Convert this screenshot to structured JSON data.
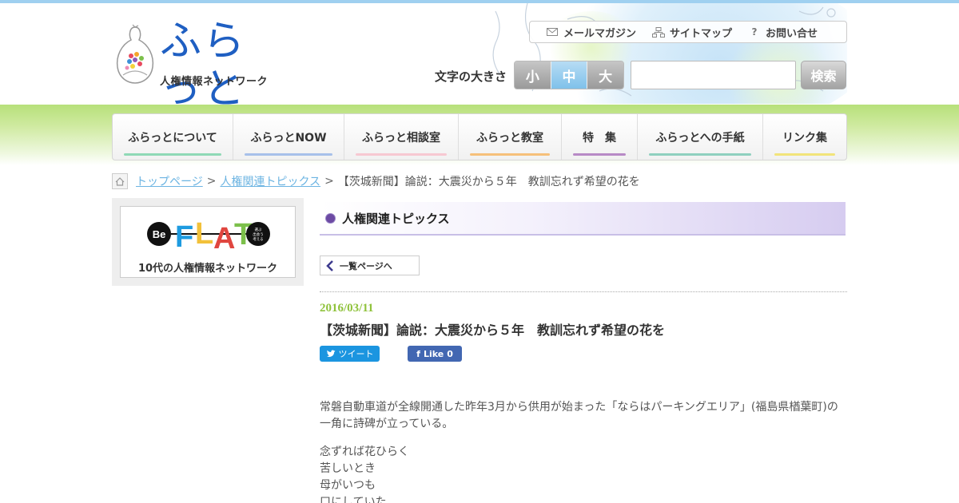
{
  "header": {
    "logo_name": "ふらっと",
    "logo_sub": "人権情報ネットワーク",
    "utility": [
      {
        "label": "メールマガジン",
        "icon": "mail-icon"
      },
      {
        "label": "サイトマップ",
        "icon": "sitemap-icon"
      },
      {
        "label": "お問い合せ",
        "icon": "question-icon"
      }
    ],
    "fontsize_label": "文字の大きさ",
    "fontsize_options": [
      "小",
      "中",
      "大"
    ],
    "fontsize_selected": "中",
    "search_value": "",
    "search_button": "検索"
  },
  "nav": {
    "items": [
      {
        "label": "ふらっとについて",
        "color": "#8fd9b6"
      },
      {
        "label": "ふらっとNOW",
        "color": "#a7c0ea"
      },
      {
        "label": "ふらっと相談室",
        "color": "#f7c8d2"
      },
      {
        "label": "ふらっと教室",
        "color": "#f6c07a"
      },
      {
        "label": "特　集",
        "color": "#b88ac6"
      },
      {
        "label": "ふらっとへの手紙",
        "color": "#8fd0bf"
      },
      {
        "label": "リンク集",
        "color": "#f2e47a"
      }
    ]
  },
  "breadcrumb": {
    "home": "トップページ",
    "category": "人権関連トピックス",
    "current": "【茨城新聞】論説：大震災から５年　教訓忘れず希望の花を",
    "separator": ">"
  },
  "sidebar": {
    "banner_be": "Be",
    "banner_flat": "FLAT",
    "banner_tag": "選ぶ 出会う 考える",
    "banner_caption": "10代の人権情報ネットワーク"
  },
  "main": {
    "section_title": "人権関連トピックス",
    "back_label": "一覧ページへ",
    "date": "2016/03/11",
    "title": "【茨城新聞】論説：大震災から５年　教訓忘れず希望の花を",
    "tweet_label": "ツイート",
    "like_label": "Like",
    "like_count": "0",
    "paragraph1": "常磐自動車道が全線開通した昨年3月から供用が始まった「ならはパーキングエリア」(福島県楢葉町)の一角に詩碑が立っている。",
    "poem": [
      "念ずれば花ひらく",
      "苦しいとき",
      "母がいつも",
      "口にしていた"
    ]
  }
}
